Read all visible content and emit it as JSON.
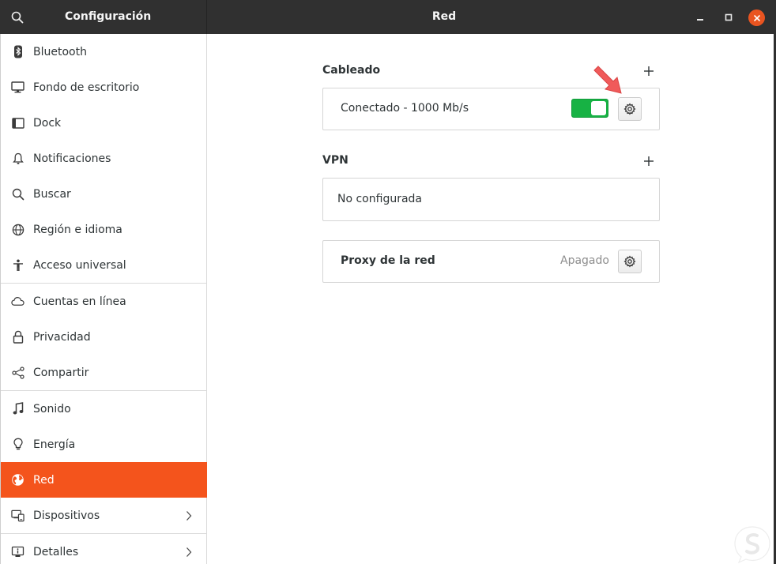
{
  "window": {
    "app_title": "Configuración",
    "page_title": "Red"
  },
  "sidebar": {
    "items": [
      {
        "label": "Bluetooth",
        "icon": "bluetooth-icon"
      },
      {
        "label": "Fondo de escritorio",
        "icon": "monitor-icon"
      },
      {
        "label": "Dock",
        "icon": "dock-icon"
      },
      {
        "label": "Notificaciones",
        "icon": "bell-icon"
      },
      {
        "label": "Buscar",
        "icon": "search-icon"
      },
      {
        "label": "Región e idioma",
        "icon": "globe-icon"
      },
      {
        "label": "Acceso universal",
        "icon": "accessibility-icon"
      },
      {
        "label": "Cuentas en línea",
        "icon": "cloud-icon"
      },
      {
        "label": "Privacidad",
        "icon": "lock-icon"
      },
      {
        "label": "Compartir",
        "icon": "share-icon"
      },
      {
        "label": "Sonido",
        "icon": "music-note-icon"
      },
      {
        "label": "Energía",
        "icon": "lightbulb-icon"
      },
      {
        "label": "Red",
        "icon": "network-globe-icon",
        "active": true
      },
      {
        "label": "Dispositivos",
        "icon": "devices-icon",
        "has_submenu": true
      },
      {
        "label": "Detalles",
        "icon": "info-icon",
        "has_submenu": true
      }
    ]
  },
  "main": {
    "wired": {
      "title": "Cableado",
      "status": "Conectado - 1000 Mb/s",
      "enabled": true
    },
    "vpn": {
      "title": "VPN",
      "status": "No configurada"
    },
    "proxy": {
      "label": "Proxy de la red",
      "status": "Apagado"
    }
  },
  "colors": {
    "accent": "#f4541c",
    "toggle_on": "#17b244",
    "headerbar": "#303030",
    "close_button": "#e95420",
    "annotation_arrow": "#f05a5a"
  }
}
